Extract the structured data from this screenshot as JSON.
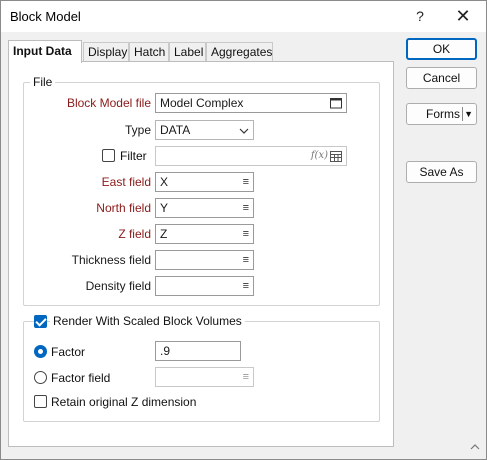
{
  "window": {
    "title": "Block Model",
    "help_label": "?",
    "close_label": "✕"
  },
  "tabs": [
    {
      "label": "Input Data",
      "active": true
    },
    {
      "label": "Display",
      "active": false
    },
    {
      "label": "Hatch",
      "active": false
    },
    {
      "label": "Label",
      "active": false
    },
    {
      "label": "Aggregates",
      "active": false
    }
  ],
  "file_group": {
    "legend": "File",
    "block_model_file": {
      "label": "Block Model file",
      "value": "Model Complex",
      "icon": "window-icon"
    },
    "type": {
      "label": "Type",
      "value": "DATA",
      "icon": "chevron-down-icon"
    },
    "filter": {
      "label": "Filter",
      "checked": false,
      "value": "",
      "icon1": "fx-icon",
      "icon2": "table-icon"
    },
    "east_field": {
      "label": "East field",
      "value": "X"
    },
    "north_field": {
      "label": "North field",
      "value": "Y"
    },
    "z_field": {
      "label": "Z field",
      "value": "Z"
    },
    "thickness_field": {
      "label": "Thickness field",
      "value": ""
    },
    "density_field": {
      "label": "Density field",
      "value": ""
    }
  },
  "render_group": {
    "legend": "Render With Scaled Block Volumes",
    "checked": true,
    "factor": {
      "label": "Factor",
      "selected": true,
      "value": ".9"
    },
    "factor_field": {
      "label": "Factor field",
      "selected": false,
      "value": ""
    },
    "retain_z": {
      "label": "Retain original Z dimension",
      "checked": false
    }
  },
  "buttons": {
    "ok": "OK",
    "cancel": "Cancel",
    "forms": "Forms",
    "save_as": "Save As"
  },
  "colors": {
    "accent": "#0067c0",
    "required_label": "#8b1a1a"
  }
}
